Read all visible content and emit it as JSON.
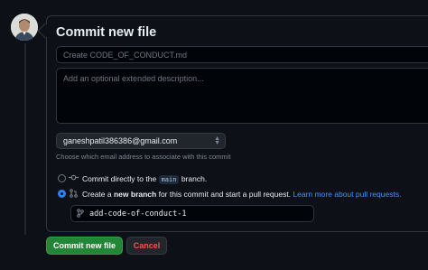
{
  "commit_form": {
    "title": "Commit new file",
    "summary_placeholder": "Create CODE_OF_CONDUCT.md",
    "description_placeholder": "Add an optional extended description...",
    "author_email": "ganeshpatil386386@gmail.com",
    "email_help": "Choose which email address to associate with this commit",
    "option_direct": {
      "prefix": "Commit directly to the",
      "branch": "main",
      "suffix": "branch.",
      "selected": false
    },
    "option_new_branch": {
      "prefix": "Create a",
      "bold": "new branch",
      "suffix": "for this commit and start a pull request.",
      "link": "Learn more about pull requests.",
      "selected": true
    },
    "branch_name": "add-code-of-conduct-1",
    "commit_button": "Commit new file",
    "cancel_button": "Cancel"
  },
  "icons": {
    "commit": "git-commit-icon",
    "pull_request": "git-pull-request-icon",
    "branch": "git-branch-icon",
    "select": "select-chevron-icon"
  },
  "colors": {
    "background": "#0d1117",
    "primary_button": "#238636",
    "danger_text": "#f85149",
    "link": "#4493f8",
    "radio_selected": "#2f81f7"
  }
}
